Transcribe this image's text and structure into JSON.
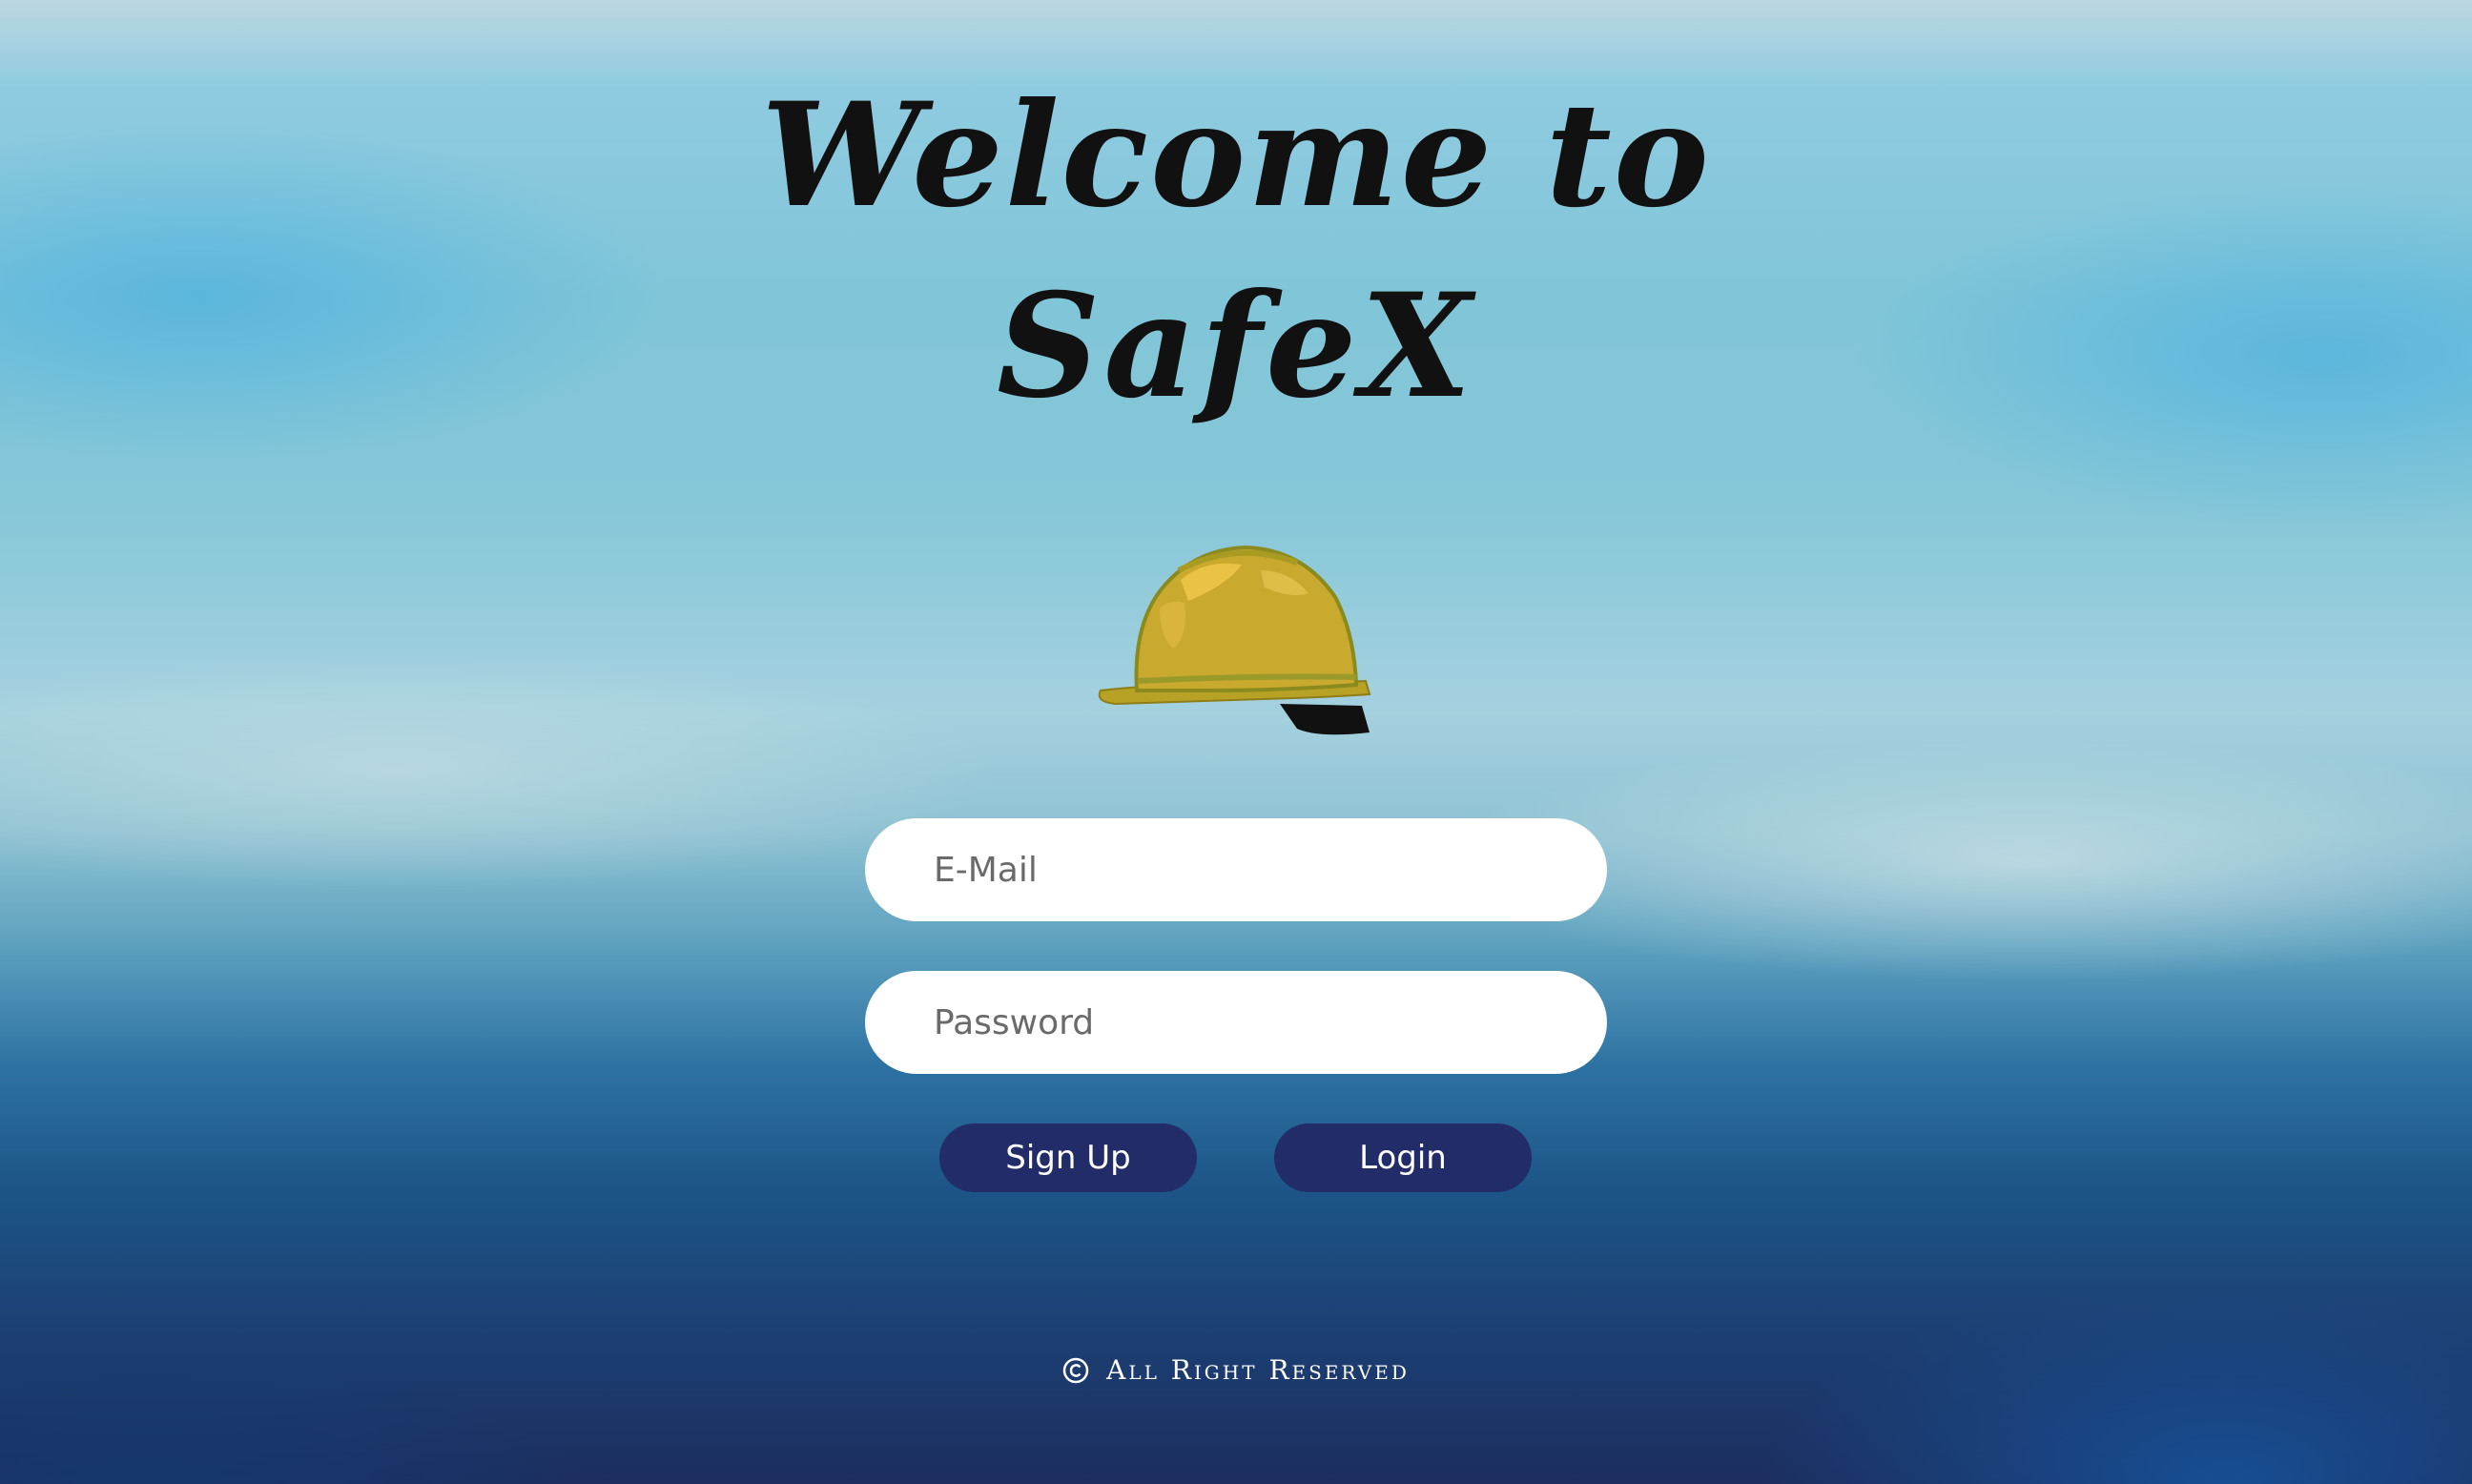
{
  "welcome": {
    "line1": "Welcome to",
    "line2": "SafeX"
  },
  "logo": {
    "icon": "hard-hat-icon",
    "color": "#c9a92e"
  },
  "form": {
    "email_placeholder": "E-Mail",
    "password_placeholder": "Password",
    "signup_label": "Sign Up",
    "login_label": "Login",
    "button_color": "#222c68"
  },
  "footer": {
    "icon": "copyright-icon",
    "text": "All Right Reserved"
  }
}
